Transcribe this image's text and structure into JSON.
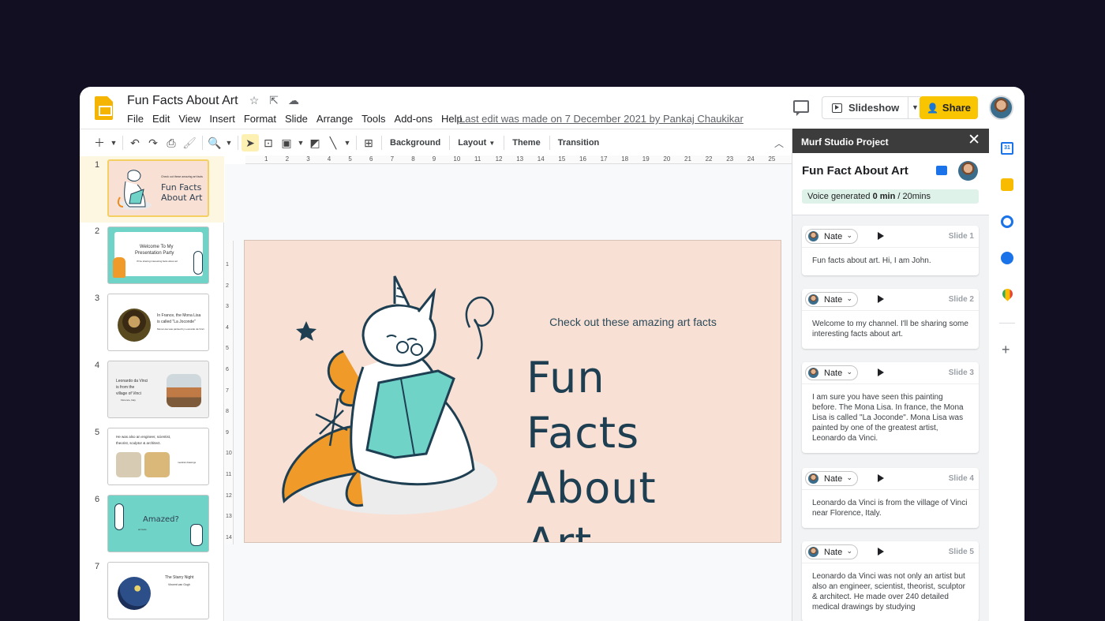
{
  "header": {
    "doc_title": "Fun Facts About Art",
    "menus": [
      "File",
      "Edit",
      "View",
      "Insert",
      "Format",
      "Slide",
      "Arrange",
      "Tools",
      "Add-ons",
      "Help"
    ],
    "last_edit": "Last edit was made on 7 December 2021 by Pankaj Chaukikar",
    "slideshow_label": "Slideshow",
    "share_label": "Share"
  },
  "toolbar": {
    "background_label": "Background",
    "layout_label": "Layout",
    "theme_label": "Theme",
    "transition_label": "Transition"
  },
  "filmstrip": {
    "slides": [
      {
        "num": "1",
        "title_lines": [
          "Fun Facts",
          "About Art"
        ],
        "sub": "Check out these amazing art facts"
      },
      {
        "num": "2",
        "title_lines": [
          "Welcome To My",
          "Presentation Party"
        ],
        "sub": "I'll be sharing interesting facts about art"
      },
      {
        "num": "3",
        "title_lines": [
          "In France, the Mona Lisa",
          "is called \"La Joconde\""
        ],
        "sub": "Mona Lisa was painted by Leonardo da Vinci"
      },
      {
        "num": "4",
        "title_lines": [
          "Leonardo da Vinci",
          "is from the",
          "village of Vinci"
        ],
        "sub": "Florence, Italy"
      },
      {
        "num": "5",
        "title_lines": [
          "He was also an engineer, scientist,",
          "theorist, sculptor & architect."
        ],
        "sub": "medical drawings"
      },
      {
        "num": "6",
        "title_lines": [
          "Amazed?"
        ],
        "sub": "art facts"
      },
      {
        "num": "7",
        "title_lines": [
          "The Starry Night"
        ],
        "sub": "Vincent van Gogh"
      }
    ]
  },
  "slide": {
    "subtitle": "Check out these amazing art facts",
    "title_line1": "Fun Facts",
    "title_line2": "About Art"
  },
  "ruler": {
    "top": [
      "1",
      "2",
      "3",
      "4",
      "5",
      "6",
      "7",
      "8",
      "9",
      "10",
      "11",
      "12",
      "13",
      "14",
      "15",
      "16",
      "17",
      "18",
      "19",
      "20",
      "21",
      "22",
      "23",
      "24",
      "25"
    ],
    "left": [
      "1",
      "2",
      "3",
      "4",
      "5",
      "6",
      "7",
      "8",
      "9",
      "10",
      "11",
      "12",
      "13",
      "14"
    ]
  },
  "panel": {
    "header": "Murf Studio Project",
    "project_title": "Fun Fact About Art",
    "voice_prefix": "Voice generated",
    "voice_used": "0 min",
    "voice_total": "/ 20mins",
    "cards": [
      {
        "voice": "Nate",
        "slide": "Slide 1",
        "text": "Fun facts about art. Hi, I am John."
      },
      {
        "voice": "Nate",
        "slide": "Slide 2",
        "text": "Welcome to my channel. I'll be sharing some interesting facts about art."
      },
      {
        "voice": "Nate",
        "slide": "Slide 3",
        "text": "I am sure you have seen this painting before. The Mona Lisa. In france, the Mona Lisa is called \"La Joconde\".  Mona Lisa was painted by one of the greatest artist, Leonardo da Vinci."
      },
      {
        "voice": "Nate",
        "slide": "Slide 4",
        "text": "Leonardo da Vinci is from the village of Vinci near Florence, Italy."
      },
      {
        "voice": "Nate",
        "slide": "Slide 5",
        "text": "Leonardo da Vinci was not only an artist but also an engineer, scientist, theorist, sculptor & architect. He made over 240 detailed medical drawings by studying"
      }
    ]
  },
  "colors": {
    "share": "#f9c400",
    "slide_bg": "#f9e0d4",
    "teal": "#6fd3c8",
    "orange": "#f08c1e",
    "navy": "#1e3f52"
  },
  "icons": [
    "star-icon",
    "move-icon",
    "cloud-icon",
    "comment-icon",
    "calendar-icon",
    "keep-icon",
    "tasks-icon",
    "contacts-icon",
    "maps-icon",
    "add-icon"
  ]
}
